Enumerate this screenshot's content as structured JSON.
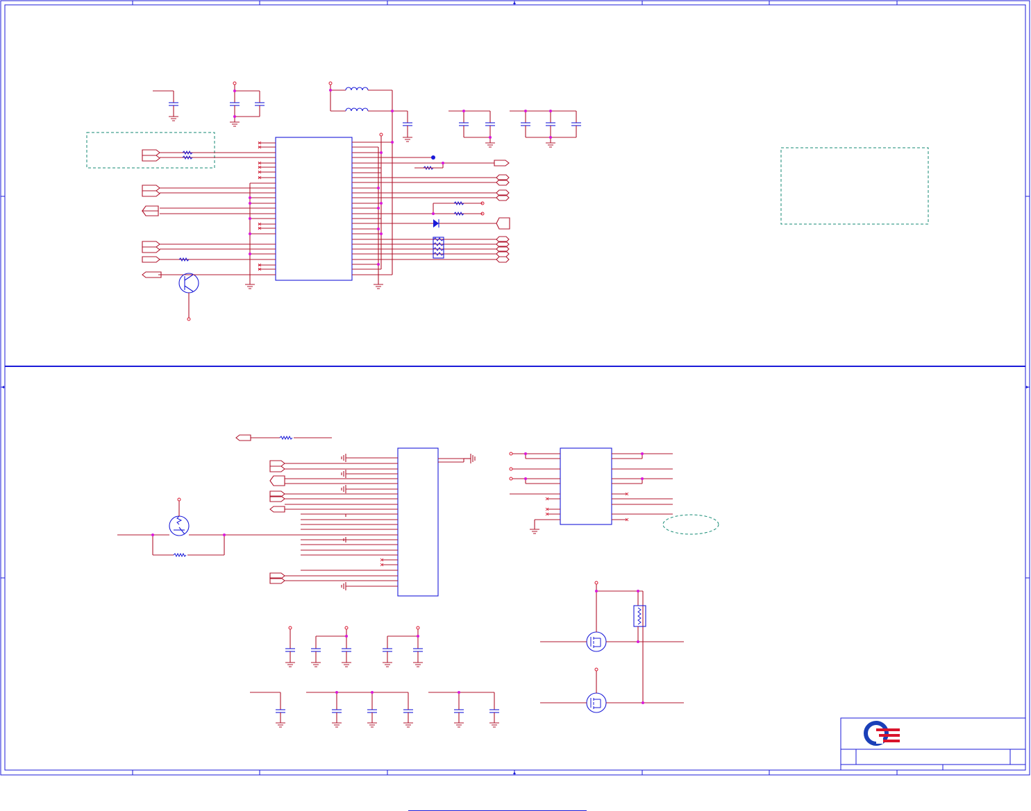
{
  "document": {
    "kind": "schematic sheet",
    "footer_link": "",
    "logo": "quanta-style-logo"
  },
  "colors": {
    "frame": "#1a1ad8",
    "wire": "#b0142c",
    "component": "#1a1ad8",
    "junction": "#d918d9",
    "note_box": "#138a73"
  },
  "icons": [
    "ground-symbol",
    "capacitor-symbol",
    "resistor-symbol",
    "inductor-symbol",
    "diode-symbol",
    "transistor-symbol",
    "mosfet-symbol",
    "fuse-symbol",
    "off-page-connector",
    "no-connect-mark"
  ]
}
